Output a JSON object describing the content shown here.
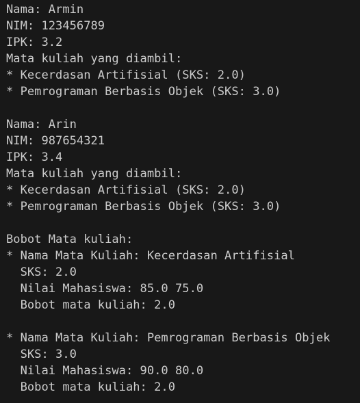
{
  "terminal": {
    "lines": [
      "Nama: Armin",
      "NIM: 123456789",
      "IPK: 3.2",
      "Mata kuliah yang diambil:",
      "* Kecerdasan Artifisial (SKS: 2.0)",
      "* Pemrograman Berbasis Objek (SKS: 3.0)",
      "",
      "Nama: Arin",
      "NIM: 987654321",
      "IPK: 3.4",
      "Mata kuliah yang diambil:",
      "* Kecerdasan Artifisial (SKS: 2.0)",
      "* Pemrograman Berbasis Objek (SKS: 3.0)",
      "",
      "Bobot Mata kuliah:",
      "* Nama Mata Kuliah: Kecerdasan Artifisial",
      "  SKS: 2.0",
      "  Nilai Mahasiswa: 85.0 75.0",
      "  Bobot mata kuliah: 2.0",
      "",
      "* Nama Mata Kuliah: Pemrograman Berbasis Objek",
      "  SKS: 3.0",
      "  Nilai Mahasiswa: 90.0 80.0",
      "  Bobot mata kuliah: 2.0"
    ]
  }
}
